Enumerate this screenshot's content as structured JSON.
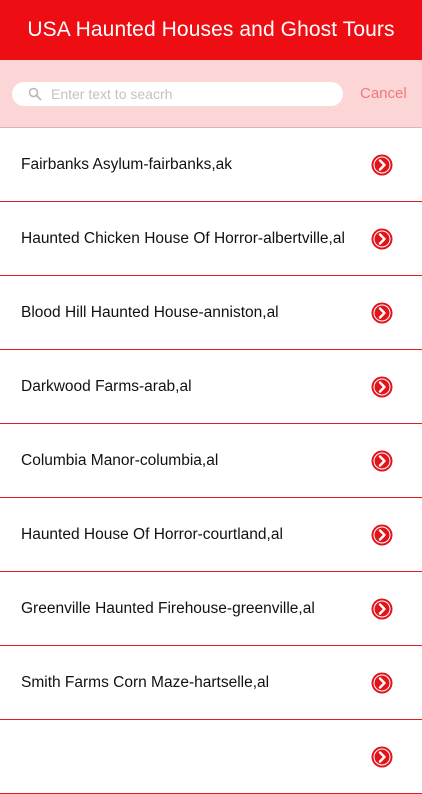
{
  "header": {
    "title": "USA Haunted Houses and Ghost Tours"
  },
  "search": {
    "placeholder": "Enter text to seacrh",
    "value": "",
    "cancel_label": "Cancel"
  },
  "colors": {
    "accent": "#ee0d13",
    "search_bg": "#fcd6d6",
    "cancel": "#ee7a7d"
  },
  "list": {
    "items": [
      {
        "label": "Fairbanks Asylum-fairbanks,ak",
        "icon": "chevron-right-circle-icon"
      },
      {
        "label": "Haunted Chicken House Of Horror-albertville,al",
        "icon": "chevron-right-circle-icon"
      },
      {
        "label": "Blood Hill Haunted House-anniston,al",
        "icon": "chevron-right-circle-icon"
      },
      {
        "label": "Darkwood Farms-arab,al",
        "icon": "chevron-right-circle-icon"
      },
      {
        "label": "Columbia Manor-columbia,al",
        "icon": "chevron-right-circle-icon"
      },
      {
        "label": "Haunted House Of Horror-courtland,al",
        "icon": "chevron-right-circle-icon"
      },
      {
        "label": "Greenville Haunted Firehouse-greenville,al",
        "icon": "chevron-right-circle-icon"
      },
      {
        "label": "Smith Farms Corn Maze-hartselle,al",
        "icon": "chevron-right-circle-icon"
      },
      {
        "label": "",
        "icon": "chevron-right-circle-icon"
      }
    ]
  }
}
